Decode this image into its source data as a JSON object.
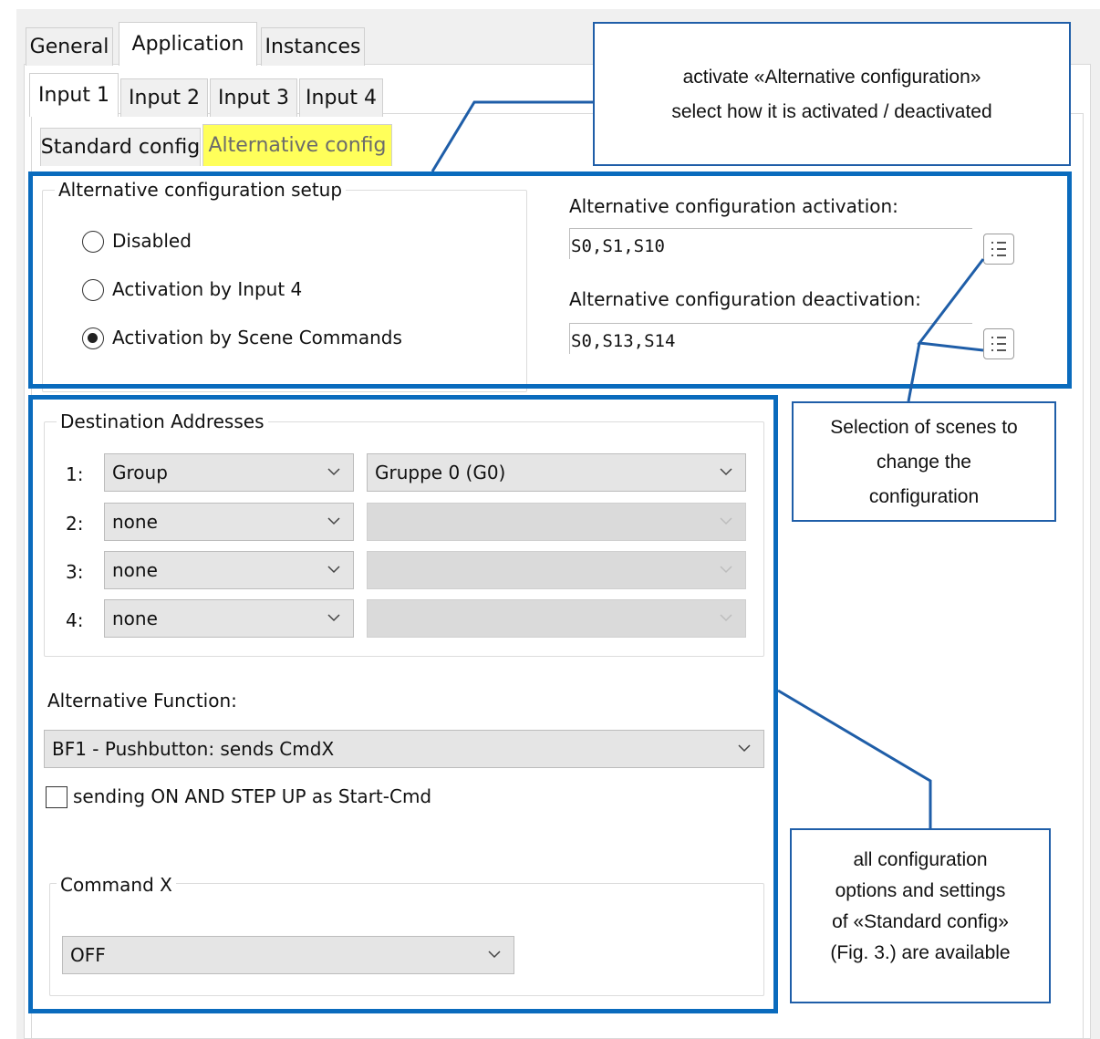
{
  "tabs_top": [
    "General",
    "Application",
    "Instances"
  ],
  "tabs_input": [
    "Input 1",
    "Input 2",
    "Input 3",
    "Input 4"
  ],
  "tabs_config": [
    "Standard config",
    "Alternative config"
  ],
  "setup": {
    "title": "Alternative configuration setup",
    "options": [
      "Disabled",
      "Activation by Input 4",
      "Activation by Scene Commands"
    ],
    "selected_index": 2
  },
  "activation": {
    "label": "Alternative configuration activation:",
    "value": "S0,S1,S10"
  },
  "deactivation": {
    "label": "Alternative configuration deactivation:",
    "value": "S0,S13,S14"
  },
  "destinations": {
    "title": "Destination Addresses",
    "rows": [
      {
        "num": "1:",
        "type": "Group",
        "target": "Gruppe 0 (G0)",
        "target_enabled": true
      },
      {
        "num": "2:",
        "type": "none",
        "target": "",
        "target_enabled": false
      },
      {
        "num": "3:",
        "type": "none",
        "target": "",
        "target_enabled": false
      },
      {
        "num": "4:",
        "type": "none",
        "target": "",
        "target_enabled": false
      }
    ]
  },
  "alt_function": {
    "label": "Alternative Function:",
    "value": "BF1 - Pushbutton:  sends CmdX"
  },
  "checkbox": {
    "label": "sending ON AND STEP UP as Start-Cmd",
    "checked": false
  },
  "command_x": {
    "title": "Command X",
    "value": "OFF"
  },
  "callouts": {
    "activate": [
      "activate «Alternative configuration»",
      "select how it is activated / deactivated"
    ],
    "scenes": [
      "Selection of scenes to",
      "change the",
      "configuration"
    ],
    "all": [
      "all configuration",
      "options and settings",
      "of «Standard config»",
      "(Fig. 3.) are available"
    ]
  },
  "colors": {
    "highlight_box": "#0a6bbd",
    "callout_border": "#1f5ea8",
    "tab_highlight": "#ffff5a"
  },
  "icons": [
    "list-icon",
    "chevron-down-icon"
  ]
}
